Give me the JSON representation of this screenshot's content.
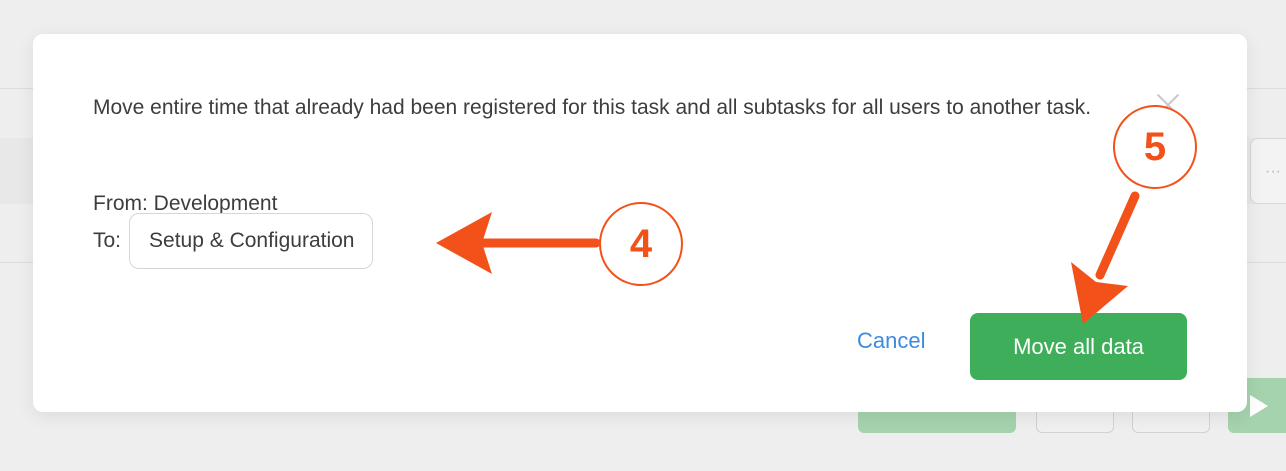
{
  "dialog": {
    "description": "Move entire time that already had been registered for this task and all subtasks for all users to another task.",
    "from_label": "From:",
    "from_value": "Development",
    "to_label": "To:",
    "to_value": "Setup & Configuration",
    "cancel_label": "Cancel",
    "confirm_label": "Move all data",
    "close_icon": "close-icon"
  },
  "annotations": {
    "step_a": "4",
    "step_b": "5",
    "accent_color": "#f2521a"
  },
  "background": {
    "menu_icon": "ellipsis-icon",
    "play_icon": "play-icon"
  },
  "colors": {
    "primary_green": "#3fae5a",
    "link_blue": "#3d8be0",
    "text": "#3d3d3d"
  }
}
